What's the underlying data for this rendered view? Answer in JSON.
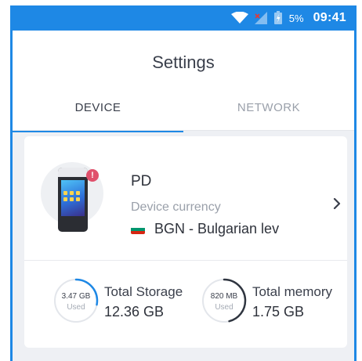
{
  "status_bar": {
    "battery_pct": "5%",
    "time": "09:41",
    "icons": [
      "wifi-icon",
      "signal-icon",
      "battery-icon"
    ],
    "color": "#1e88e5"
  },
  "header": {
    "title": "Settings"
  },
  "tabs": [
    {
      "label": "DEVICE",
      "active": true
    },
    {
      "label": "NETWORK",
      "active": false
    }
  ],
  "device": {
    "name": "PD",
    "currency_label": "Device currency",
    "currency_value": "BGN - Bulgarian lev",
    "flag_colors": [
      "#ffffff",
      "#00966e",
      "#d62612"
    ],
    "alert_badge": "!"
  },
  "storage": {
    "used_value": "3.47 GB",
    "used_label": "Used",
    "title": "Total Storage",
    "total": "12.36 GB",
    "fraction_used": 0.28
  },
  "memory": {
    "used_value": "820 MB",
    "used_label": "Used",
    "title": "Total memory",
    "total": "1.75 GB",
    "fraction_used": 0.46
  },
  "colors": {
    "accent": "#1e88e5",
    "background": "#eef0f4",
    "alert": "#e0506b"
  }
}
